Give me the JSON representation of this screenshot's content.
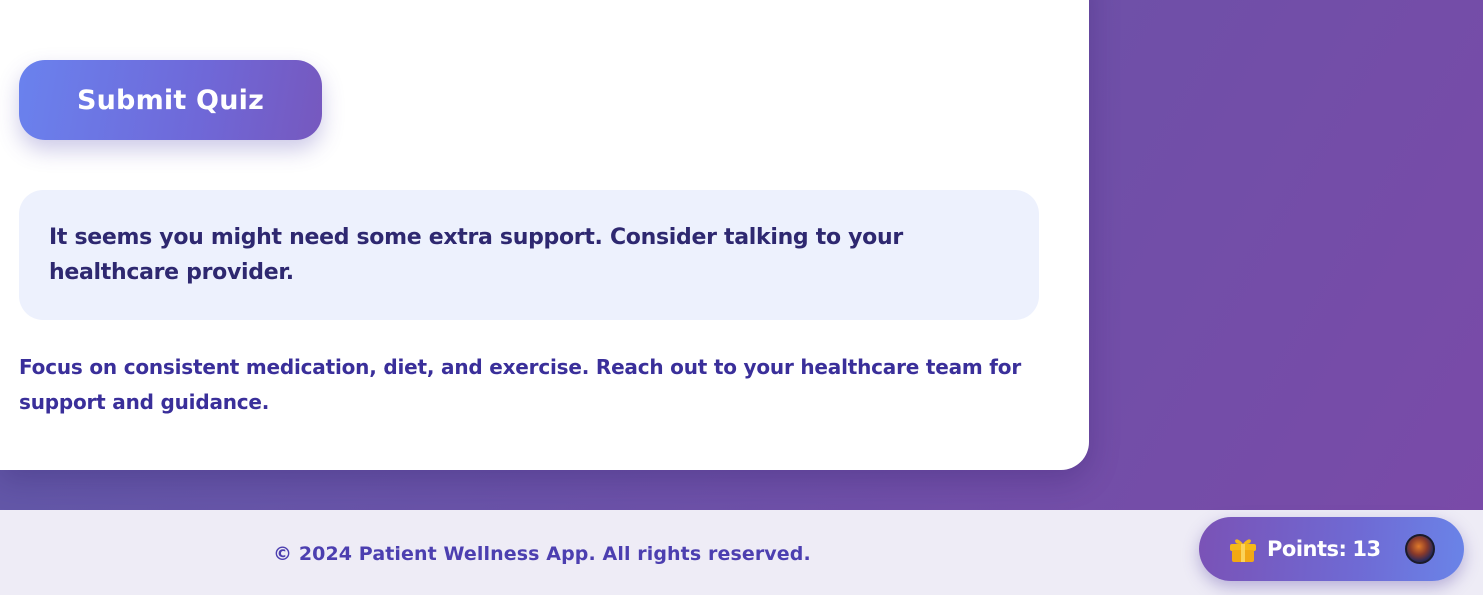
{
  "quiz": {
    "submit_label": "Submit Quiz"
  },
  "result": {
    "message": "It seems you might need some extra support. Consider talking to your healthcare provider.",
    "advice": "Focus on consistent medication, diet, and exercise. Reach out to your healthcare team for support and guidance."
  },
  "footer": {
    "copyright": "© 2024 Patient Wellness App. All rights reserved."
  },
  "points": {
    "label": "Points:",
    "value": "13",
    "icon": "gift-icon"
  },
  "colors": {
    "accent": "#6f68d8",
    "text_dark": "#2e2870",
    "notice_bg": "#edf1fd",
    "gift": "#f5b919"
  }
}
